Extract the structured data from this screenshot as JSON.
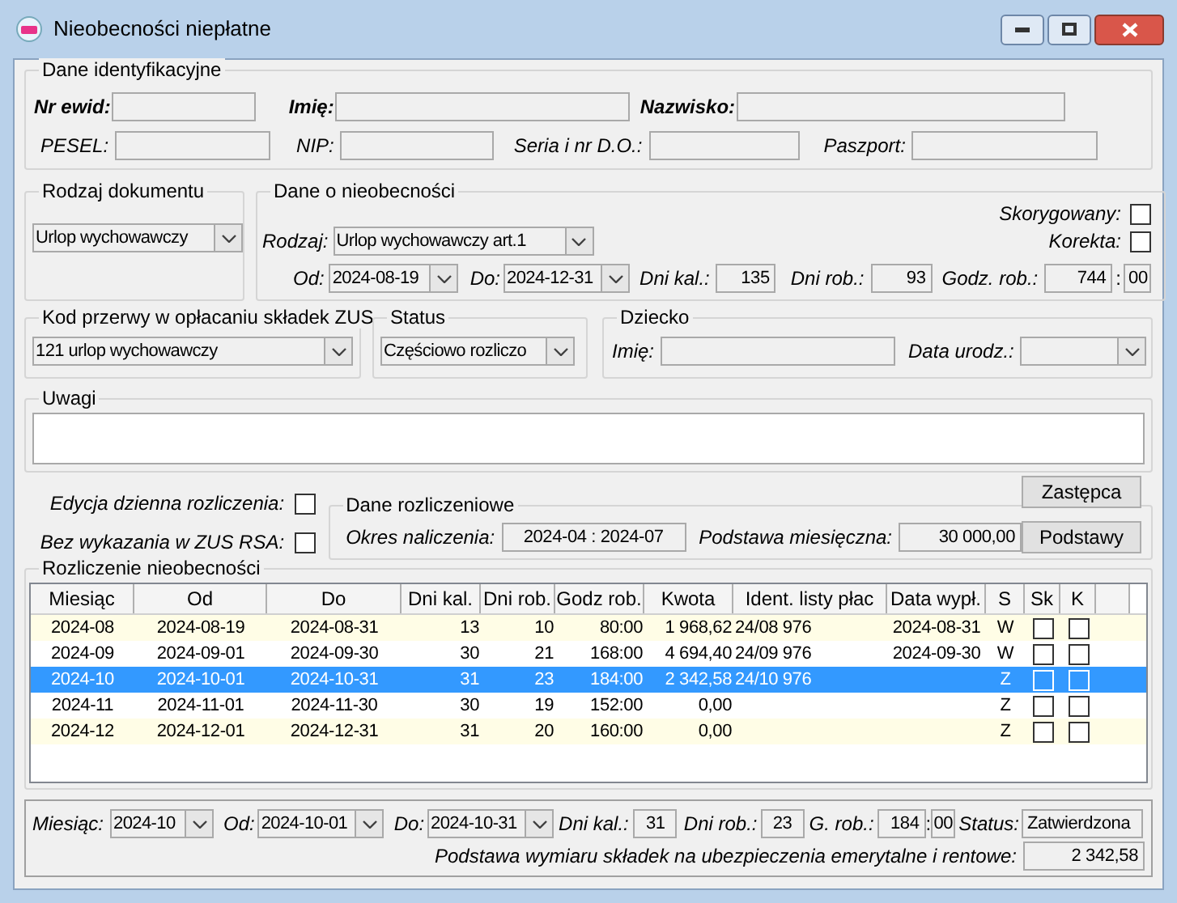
{
  "window": {
    "title": "Nieobecności niepłatne"
  },
  "identification": {
    "title": "Dane identyfikacyjne",
    "fields": [
      {
        "label": "Nr ewid:",
        "kind": "primary"
      },
      {
        "label": "Imię:",
        "kind": "primary"
      },
      {
        "label": "Nazwisko:",
        "kind": "primary"
      },
      {
        "label": "PESEL:",
        "kind": "secondary"
      },
      {
        "label": "NIP:",
        "kind": "secondary"
      },
      {
        "label": "Seria i nr D.O.:",
        "kind": "secondary"
      },
      {
        "label": "Paszport:",
        "kind": "secondary"
      }
    ]
  },
  "document_type": {
    "title": "Rodzaj dokumentu",
    "value": "Urlop wychowawczy"
  },
  "absence": {
    "title": "Dane o nieobecności",
    "type_label": "Rodzaj:",
    "type_value": "Urlop wychowawczy art.1",
    "corrected": {
      "label": "Skorygowany:",
      "checked": false
    },
    "correction": {
      "label": "Korekta:",
      "checked": false
    },
    "from": {
      "label": "Od:",
      "value": "2024-08-19"
    },
    "to": {
      "label": "Do:",
      "value": "2024-12-31"
    },
    "cal_days": {
      "label": "Dni kal.:",
      "value": "135"
    },
    "work_days": {
      "label": "Dni rob.:",
      "value": "93"
    },
    "work_hours": {
      "label": "Godz. rob.:",
      "hours": "744",
      "separator": ":",
      "minutes": "00"
    }
  },
  "zus_break": {
    "title": "Kod przerwy w opłacaniu składek ZUS",
    "value": "121 urlop wychowawczy"
  },
  "status": {
    "title": "Status",
    "value": "Częściowo rozliczo"
  },
  "child": {
    "title": "Dziecko",
    "name_label": "Imię:",
    "birth_label": "Data urodz.:"
  },
  "notes": {
    "title": "Uwagi"
  },
  "daily_edit": {
    "label": "Edycja dzienna rozliczenia:",
    "checked": false
  },
  "no_zus_rsa": {
    "label": "Bez wykazania w ZUS RSA:",
    "checked": false
  },
  "substitute_button": "Zastępca",
  "settlement": {
    "title": "Dane rozliczeniowe",
    "period_label": "Okres naliczenia:",
    "period": "2024-04 : 2024-07",
    "base_label": "Podstawa miesięczna:",
    "base": "30 000,00"
  },
  "bases_button": "Podstawy",
  "table": {
    "title": "Rozliczenie nieobecności",
    "columns": [
      "Miesiąc",
      "Od",
      "Do",
      "Dni kal.",
      "Dni rob.",
      "Godz rob.",
      "Kwota",
      "Ident. listy płac",
      "Data wypł.",
      "S",
      "Sk",
      "K"
    ],
    "rows": [
      {
        "cells": [
          "2024-08",
          "2024-08-19",
          "2024-08-31",
          "13",
          "10",
          "80:00",
          "1 968,62",
          "24/08 976",
          "2024-08-31",
          "W"
        ],
        "sk": false,
        "k": false,
        "selected": false
      },
      {
        "cells": [
          "2024-09",
          "2024-09-01",
          "2024-09-30",
          "30",
          "21",
          "168:00",
          "4 694,40",
          "24/09 976",
          "2024-09-30",
          "W"
        ],
        "sk": false,
        "k": false,
        "selected": false
      },
      {
        "cells": [
          "2024-10",
          "2024-10-01",
          "2024-10-31",
          "31",
          "23",
          "184:00",
          "2 342,58",
          "24/10 976",
          "",
          "Z"
        ],
        "sk": false,
        "k": false,
        "selected": true
      },
      {
        "cells": [
          "2024-11",
          "2024-11-01",
          "2024-11-30",
          "30",
          "19",
          "152:00",
          "0,00",
          "",
          "",
          "Z"
        ],
        "sk": false,
        "k": false,
        "selected": false
      },
      {
        "cells": [
          "2024-12",
          "2024-12-01",
          "2024-12-31",
          "31",
          "20",
          "160:00",
          "0,00",
          "",
          "",
          "Z"
        ],
        "sk": false,
        "k": false,
        "selected": false
      }
    ]
  },
  "detail": {
    "month": {
      "label": "Miesiąc:",
      "value": "2024-10"
    },
    "from": {
      "label": "Od:",
      "value": "2024-10-01"
    },
    "to": {
      "label": "Do:",
      "value": "2024-10-31"
    },
    "cal_days": {
      "label": "Dni kal.:",
      "value": "31"
    },
    "work_days": {
      "label": "Dni rob.:",
      "value": "23"
    },
    "hours": {
      "label": "G. rob.:",
      "hours": "184",
      "separator": ":",
      "minutes": "00"
    },
    "status": {
      "label": "Status:",
      "value": "Zatwierdzona"
    },
    "basis_label": "Podstawa wymiaru składek na ubezpieczenia emerytalne i rentowe:",
    "basis": "2 342,58"
  }
}
